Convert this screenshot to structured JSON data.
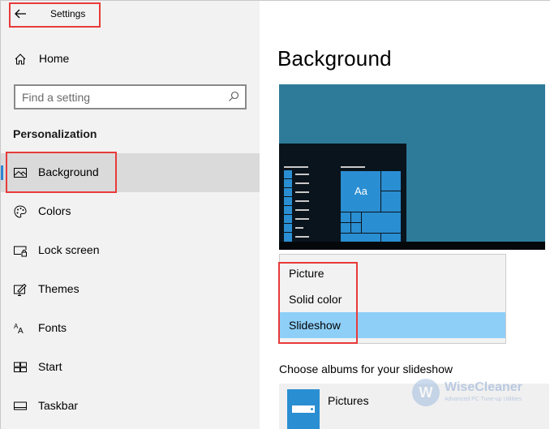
{
  "window": {
    "title": "Settings"
  },
  "sidebar": {
    "home_label": "Home",
    "search": {
      "placeholder": "Find a setting",
      "value": ""
    },
    "section_title": "Personalization",
    "items": [
      {
        "label": "Background",
        "icon": "image-icon",
        "selected": true
      },
      {
        "label": "Colors",
        "icon": "palette-icon",
        "selected": false
      },
      {
        "label": "Lock screen",
        "icon": "lock-screen-icon",
        "selected": false
      },
      {
        "label": "Themes",
        "icon": "themes-icon",
        "selected": false
      },
      {
        "label": "Fonts",
        "icon": "fonts-icon",
        "selected": false
      },
      {
        "label": "Start",
        "icon": "start-icon",
        "selected": false
      },
      {
        "label": "Taskbar",
        "icon": "taskbar-icon",
        "selected": false
      }
    ]
  },
  "main": {
    "title": "Background",
    "preview": {
      "tile_text": "Aa",
      "desktop_color": "#2e7b99",
      "accent_color": "#2a8ed2"
    },
    "background_dropdown": {
      "options": [
        "Picture",
        "Solid color",
        "Slideshow"
      ],
      "selected": "Slideshow"
    },
    "albums_label": "Choose albums for your slideshow",
    "albums": [
      {
        "name": "Pictures"
      }
    ]
  },
  "annotations": {
    "highlight_color": "#e83a3a"
  },
  "watermark": {
    "logo_letter": "W",
    "name": "WiseCleaner",
    "tagline": "Advanced PC Tune-up Utilities"
  }
}
